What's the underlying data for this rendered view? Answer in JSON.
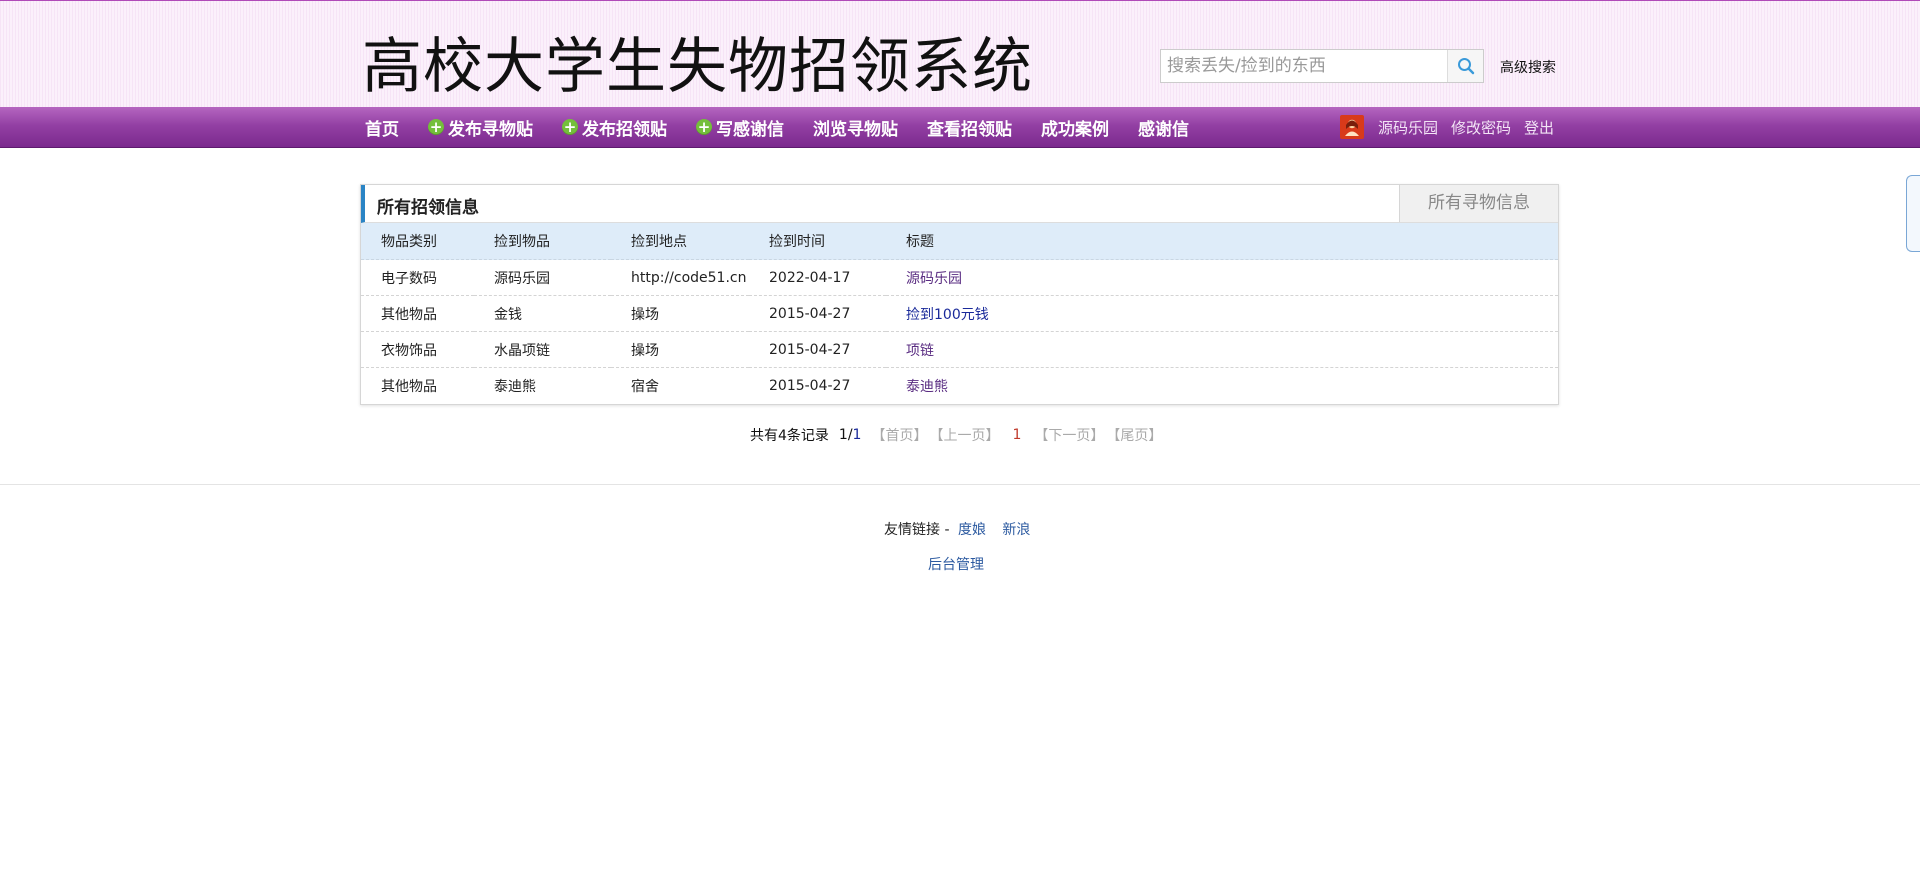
{
  "header": {
    "site_title": "高校大学生失物招领系统",
    "search_placeholder": "搜索丢失/捡到的东西",
    "search_icon": "search-icon",
    "advanced_search": "高级搜索"
  },
  "nav": {
    "items": [
      {
        "label": "首页",
        "icon": ""
      },
      {
        "label": "发布寻物贴",
        "icon": "plus-icon"
      },
      {
        "label": "发布招领贴",
        "icon": "plus-icon"
      },
      {
        "label": "写感谢信",
        "icon": "plus-icon"
      },
      {
        "label": "浏览寻物贴",
        "icon": ""
      },
      {
        "label": "查看招领贴",
        "icon": ""
      },
      {
        "label": "成功案例",
        "icon": ""
      },
      {
        "label": "感谢信",
        "icon": ""
      }
    ],
    "user": {
      "avatar_icon": "user-avatar-icon",
      "username": "源码乐园",
      "change_password": "修改密码",
      "logout": "登出"
    }
  },
  "panel": {
    "title": "所有招领信息",
    "other_tab": "所有寻物信息",
    "columns": [
      "物品类别",
      "捡到物品",
      "捡到地点",
      "捡到时间",
      "标题"
    ],
    "rows": [
      {
        "category": "电子数码",
        "item": "源码乐园",
        "place": "http://code51.cn",
        "time": "2022-04-17",
        "title": "源码乐园"
      },
      {
        "category": "其他物品",
        "item": "金钱",
        "place": "操场",
        "time": "2015-04-27",
        "title": "捡到100元钱"
      },
      {
        "category": "衣物饰品",
        "item": "水晶项链",
        "place": "操场",
        "time": "2015-04-27",
        "title": "项链"
      },
      {
        "category": "其他物品",
        "item": "泰迪熊",
        "place": "宿舍",
        "time": "2015-04-27",
        "title": "泰迪熊"
      }
    ]
  },
  "pagination": {
    "total_records": "共有4条记录",
    "page_indicator_current": "1/",
    "page_indicator_total": "1",
    "first": "【首页】",
    "prev": "【上一页】",
    "current": "1",
    "next": "【下一页】",
    "last": "【尾页】"
  },
  "footer": {
    "friend_links_label": "友情链接 -",
    "links": [
      "度娘",
      "新浪"
    ],
    "admin": "后台管理"
  },
  "colors": {
    "nav_purple": "#9340a4",
    "panel_accent": "#2a84c5",
    "table_header_bg": "#deecf9",
    "link_blue": "#2c5aa0"
  }
}
